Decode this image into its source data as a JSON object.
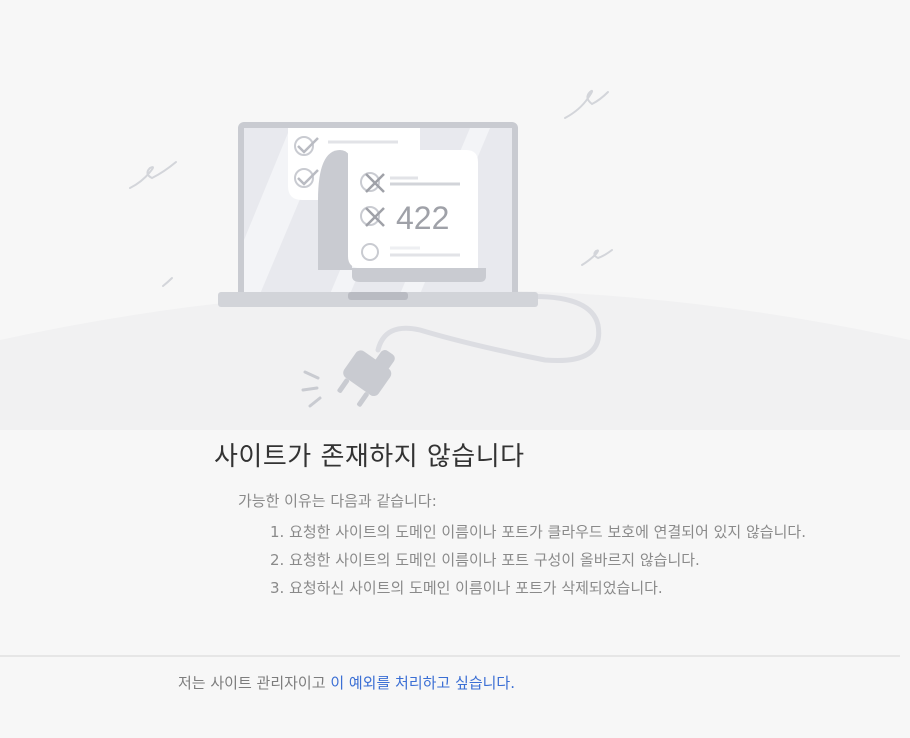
{
  "illustration": {
    "status_code": "422"
  },
  "title": "사이트가 존재하지 않습니다",
  "reasons": {
    "intro": "가능한 이유는 다음과 같습니다:",
    "items": [
      "1. 요청한 사이트의 도메인 이름이나 포트가 클라우드 보호에 연결되어 있지 않습니다.",
      "2. 요청한 사이트의 도메인 이름이나 포트 구성이 올바르지 않습니다.",
      "3. 요청하신 사이트의 도메인 이름이나 포트가 삭제되었습니다."
    ]
  },
  "footer": {
    "text": "저는 사이트 관리자이고 ",
    "link_label": "이 예외를 처리하고 싶습니다."
  },
  "colors": {
    "background": "#f7f7f7",
    "title": "#333333",
    "body_text": "#8a8a8a",
    "link": "#3b6fd4",
    "illustration_gray": "#c9cbd1"
  }
}
